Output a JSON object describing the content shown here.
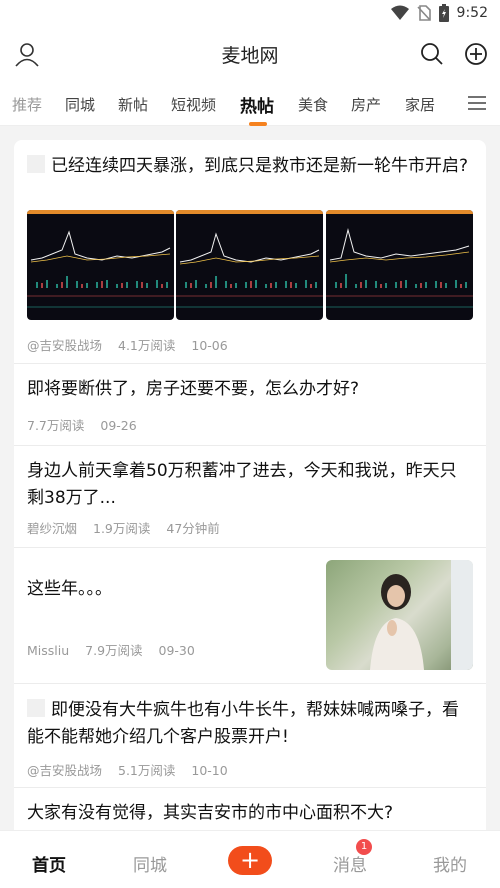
{
  "status": {
    "time": "9:52"
  },
  "header": {
    "title": "麦地网"
  },
  "tabs": [
    {
      "label": "推荐"
    },
    {
      "label": "同城"
    },
    {
      "label": "新帖"
    },
    {
      "label": "短视频"
    },
    {
      "label": "热帖"
    },
    {
      "label": "美食"
    },
    {
      "label": "房产"
    },
    {
      "label": "家居"
    }
  ],
  "posts": [
    {
      "title": "已经连续四天暴涨，到底只是救市还是新一轮牛市开启?",
      "author": "@吉安股战场",
      "reads": "4.1万阅读",
      "time": "10-06"
    },
    {
      "title": "即将要断供了，房子还要不要，怎么办才好?",
      "reads": "7.7万阅读",
      "time": "09-26"
    },
    {
      "title": "身边人前天拿着50万积蓄冲了进去，今天和我说，昨天只剩38万了...",
      "author": "碧纱沉烟",
      "reads": "1.9万阅读",
      "time": "47分钟前"
    },
    {
      "title": "这些年。。。",
      "author": "Missliu",
      "reads": "7.9万阅读",
      "time": "09-30"
    },
    {
      "title": "即便没有大牛疯牛也有小牛长牛，帮妹妹喊两嗓子，看能不能帮她介绍几个客户股票开户!",
      "author": "@吉安股战场",
      "reads": "5.1万阅读",
      "time": "10-10"
    },
    {
      "title": "大家有没有觉得，其实吉安市的市中心面积不大?"
    }
  ],
  "bottom_nav": {
    "home": "首页",
    "local": "同城",
    "post": "+",
    "messages": "消息",
    "messages_badge": "1",
    "mine": "我的"
  }
}
